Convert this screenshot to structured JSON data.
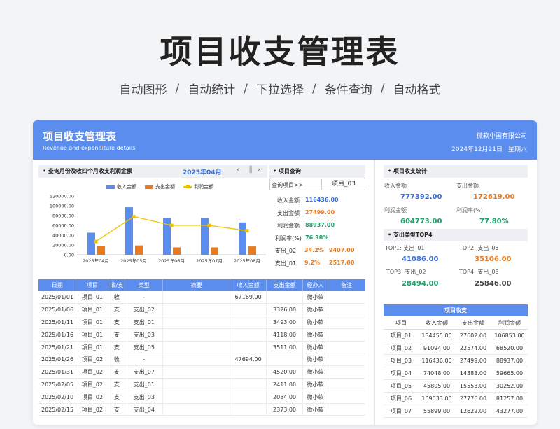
{
  "hero": {
    "title": "项目收支管理表",
    "features": [
      "自动图形",
      "自动统计",
      "下拉选择",
      "条件查询",
      "自动格式"
    ],
    "separator": "/"
  },
  "banner": {
    "title": "项目收支管理表",
    "subtitle": "Revenue and expenditure details",
    "company": "微软中国有限公司",
    "date": "2024年12月21日",
    "weekday": "星期六"
  },
  "chart_section": {
    "header": "• 查询月份及收四个月收支利润金额",
    "month": "2025年04月",
    "prev": "‹",
    "next": "›",
    "handle": "▐"
  },
  "chart_data": {
    "type": "bar",
    "categories": [
      "2025年04月",
      "2025年05月",
      "2025年06月",
      "2025年07月",
      "2025年08月"
    ],
    "series": [
      {
        "name": "收入金额",
        "type": "bar",
        "color": "#5b8def",
        "values": [
          45000,
          97000,
          75000,
          75000,
          66000
        ]
      },
      {
        "name": "支出金额",
        "type": "bar",
        "color": "#ea7a1e",
        "values": [
          18000,
          19000,
          15000,
          15000,
          17000
        ]
      },
      {
        "name": "利润金额",
        "type": "line",
        "color": "#f2c300",
        "values": [
          27000,
          78000,
          60000,
          60000,
          49000
        ]
      }
    ],
    "yticks": [
      "120000.00",
      "100000.00",
      "80000.00",
      "60000.00",
      "40000.00",
      "20000.00",
      "0.00"
    ],
    "ylim": [
      0,
      120000
    ]
  },
  "query": {
    "header": "• 项目查询",
    "select_label": "查询项目>>",
    "select_value": "项目_03",
    "rows": [
      {
        "label": "收入金额",
        "value": "116436.00",
        "color": "blue"
      },
      {
        "label": "支出金额",
        "value": "27499.00",
        "color": "orange"
      },
      {
        "label": "利润金额",
        "value": "88937.00",
        "color": "green"
      },
      {
        "label": "利润率(%)",
        "value": "76.38%",
        "color": "green"
      }
    ],
    "expenses": [
      {
        "label": "支出_02",
        "pct": "34.2%",
        "amount": "9407.00"
      },
      {
        "label": "支出_01",
        "pct": "9.2%",
        "amount": "2517.00"
      }
    ]
  },
  "detail": {
    "headers": [
      "日期",
      "项目",
      "收/支",
      "类型",
      "摘要",
      "收入金额",
      "支出金额",
      "经办人",
      "备注"
    ],
    "rows": [
      [
        "2025/01/01",
        "项目_01",
        "收",
        "-",
        "",
        "67169.00",
        "",
        "微小软",
        ""
      ],
      [
        "2025/01/06",
        "项目_01",
        "支",
        "支出_02",
        "",
        "",
        "3326.00",
        "微小软",
        ""
      ],
      [
        "2025/01/11",
        "项目_01",
        "支",
        "支出_01",
        "",
        "",
        "3493.00",
        "微小软",
        ""
      ],
      [
        "2025/01/16",
        "项目_01",
        "支",
        "支出_03",
        "",
        "",
        "4118.00",
        "微小软",
        ""
      ],
      [
        "2025/01/21",
        "项目_01",
        "支",
        "支出_05",
        "",
        "",
        "3511.00",
        "微小软",
        ""
      ],
      [
        "2025/01/26",
        "项目_02",
        "收",
        "-",
        "",
        "47694.00",
        "",
        "微小软",
        ""
      ],
      [
        "2025/01/31",
        "项目_02",
        "支",
        "支出_07",
        "",
        "",
        "4520.00",
        "微小软",
        ""
      ],
      [
        "2025/02/05",
        "项目_02",
        "支",
        "支出_01",
        "",
        "",
        "2411.00",
        "微小软",
        ""
      ],
      [
        "2025/02/10",
        "项目_02",
        "支",
        "支出_03",
        "",
        "",
        "2084.00",
        "微小软",
        ""
      ],
      [
        "2025/02/15",
        "项目_02",
        "支",
        "支出_04",
        "",
        "",
        "2373.00",
        "微小软",
        ""
      ]
    ]
  },
  "stats": {
    "header": "• 项目收支统计",
    "income_label": "收入金额",
    "income": "777392.00",
    "expense_label": "支出金额",
    "expense": "172619.00",
    "profit_label": "利润金额",
    "profit": "604773.00",
    "rate_label": "利润率(%)",
    "rate": "77.80%"
  },
  "top": {
    "header": "• 支出类型TOP4",
    "items": [
      {
        "label": "TOP1: 支出_01",
        "value": "41086.00"
      },
      {
        "label": "TOP2: 支出_05",
        "value": "35106.00"
      },
      {
        "label": "TOP3: 支出_02",
        "value": "28494.00"
      },
      {
        "label": "TOP4: 支出_03",
        "value": "25846.00"
      }
    ]
  },
  "projects": {
    "title": "项目收支",
    "headers": [
      "项目",
      "收入金额",
      "支出金额",
      "利润金额"
    ],
    "rows": [
      [
        "项目_01",
        "134455.00",
        "27602.00",
        "106853.00"
      ],
      [
        "项目_02",
        "91094.00",
        "22574.00",
        "68520.00"
      ],
      [
        "项目_03",
        "116436.00",
        "27499.00",
        "88937.00"
      ],
      [
        "项目_04",
        "74048.00",
        "14383.00",
        "59665.00"
      ],
      [
        "项目_05",
        "45805.00",
        "15553.00",
        "30252.00"
      ],
      [
        "项目_06",
        "109033.00",
        "27776.00",
        "81257.00"
      ],
      [
        "项目_07",
        "55899.00",
        "12622.00",
        "43277.00"
      ]
    ]
  }
}
